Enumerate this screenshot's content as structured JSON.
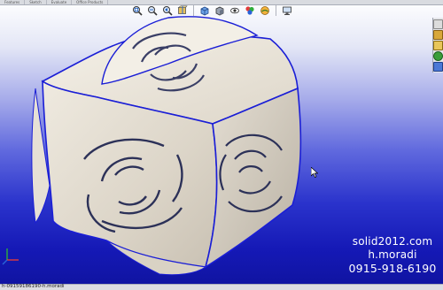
{
  "top_tabs": [
    "Features",
    "Sketch",
    "Evaluate",
    "Office Products"
  ],
  "hud_icons": [
    "zoom-fit-icon",
    "zoom-area-icon",
    "previous-view-icon",
    "section-view-icon",
    "view-orientation-icon",
    "display-style-icon",
    "hide-show-items-icon",
    "edit-appearance-icon",
    "apply-scene-icon",
    "view-settings-icon"
  ],
  "taskpane_icons": [
    "solidworks-resources-icon",
    "design-library-icon",
    "file-explorer-icon",
    "view-palette-icon",
    "appearances-icon"
  ],
  "watermark": {
    "site": "solid2012.com",
    "name": "h.moradi",
    "phone": "0915-918-6190"
  },
  "status_bar": {
    "text": "h-09159186190-h.moradi"
  },
  "colors": {
    "bg_top": "#ffffff",
    "bg_bottom": "#0f139e",
    "model_body": "#ece7dd",
    "edge_highlight": "#1a1ed6"
  }
}
